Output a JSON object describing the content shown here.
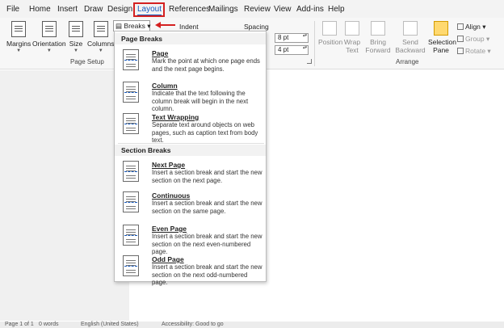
{
  "menu": {
    "tabs": [
      "File",
      "Home",
      "Insert",
      "Draw",
      "Design",
      "Layout",
      "References",
      "Mailings",
      "Review",
      "View",
      "Add-ins",
      "Help"
    ],
    "active": "Layout"
  },
  "ribbon": {
    "page_setup": {
      "buttons": [
        "Margins",
        "Orientation",
        "Size",
        "Columns"
      ],
      "label": "Page Setup"
    },
    "breaks_label": "Breaks",
    "indent_label": "Indent",
    "spacing_label": "Spacing",
    "spacing_before": "8 pt",
    "spacing_after": "4 pt",
    "arrange": {
      "position": "Position",
      "wrap": "Wrap Text",
      "bring": "Bring Forward",
      "send": "Send Backward",
      "selection": "Selection Pane",
      "align": "Align",
      "group": "Group",
      "rotate": "Rotate",
      "label": "Arrange"
    }
  },
  "breaks_menu": {
    "page_breaks_header": "Page Breaks",
    "section_breaks_header": "Section Breaks",
    "page_items": [
      {
        "title": "Page",
        "desc": "Mark the point at which one page ends and the next page begins."
      },
      {
        "title": "Column",
        "desc": "Indicate that the text following the column break will begin in the next column."
      },
      {
        "title": "Text Wrapping",
        "desc": "Separate text around objects on web pages, such as caption text from body text."
      }
    ],
    "section_items": [
      {
        "title": "Next Page",
        "desc": "Insert a section break and start the new section on the next page."
      },
      {
        "title": "Continuous",
        "desc": "Insert a section break and start the new section on the same page."
      },
      {
        "title": "Even Page",
        "desc": "Insert a section break and start the new section on the next even-numbered page."
      },
      {
        "title": "Odd Page",
        "desc": "Insert a section break and start the new section on the next odd-numbered page."
      }
    ]
  },
  "status": {
    "page": "Page 1 of 1",
    "words": "0 words",
    "language": "English (United States)",
    "accessibility": "Accessibility: Good to go"
  },
  "colors": {
    "accent": "#185abd",
    "highlight": "#d42020"
  }
}
